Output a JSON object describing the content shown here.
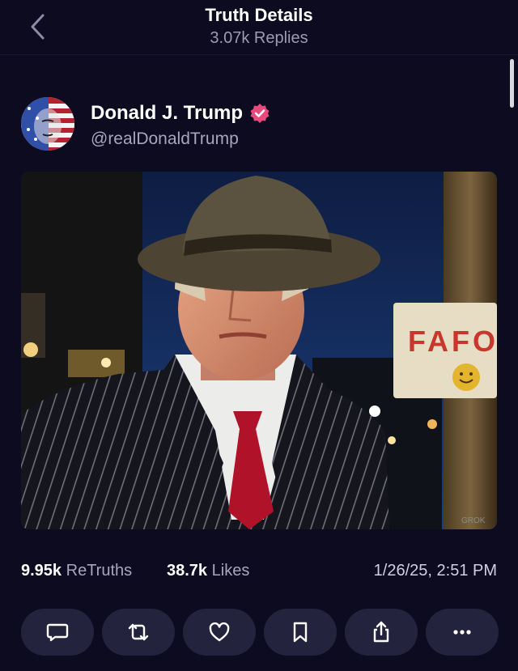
{
  "header": {
    "title": "Truth Details",
    "subtitle": "3.07k Replies"
  },
  "author": {
    "name": "Donald J. Trump",
    "handle": "@realDonaldTrump",
    "verified": true
  },
  "media": {
    "sign_text": "FAFO",
    "watermark": "GROK"
  },
  "stats": {
    "retruths_count": "9.95k",
    "retruths_label": "ReTruths",
    "likes_count": "38.7k",
    "likes_label": "Likes",
    "timestamp": "1/26/25, 2:51 PM"
  },
  "actions": [
    {
      "icon": "reply-icon"
    },
    {
      "icon": "retruth-icon"
    },
    {
      "icon": "heart-icon"
    },
    {
      "icon": "bookmark-icon"
    },
    {
      "icon": "share-icon"
    },
    {
      "icon": "more-icon"
    }
  ],
  "colors": {
    "background": "#0c0b1f",
    "button": "#24233d",
    "verified_badge": "#e84a7b",
    "secondary_text": "#a7a6bc"
  }
}
